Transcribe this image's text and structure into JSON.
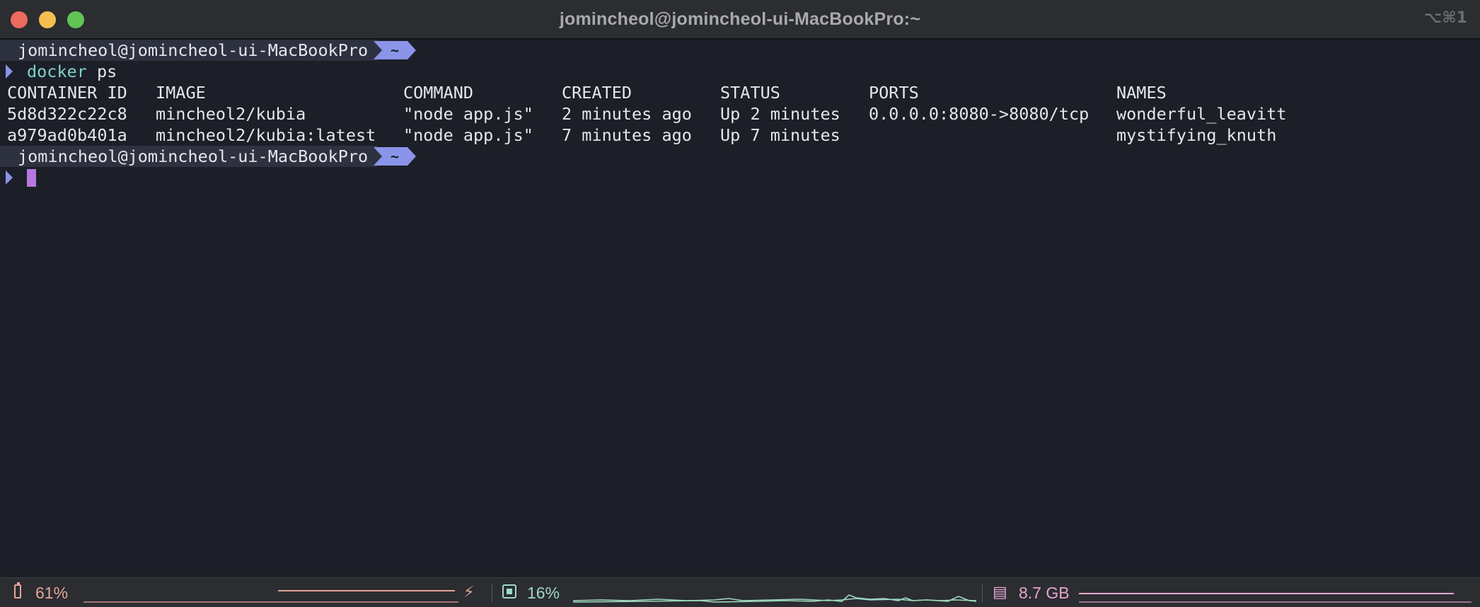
{
  "window": {
    "title": "jomincheol@jomincheol-ui-MacBookPro:~",
    "shortcut": "⌥⌘1",
    "traffic_colors": {
      "close": "#ed6a5e",
      "minimize": "#f5bf4f",
      "maximize": "#61c554"
    }
  },
  "prompt": {
    "host": "jomincheol@jomincheol-ui-MacBookPro",
    "dir": "~"
  },
  "command": {
    "name": "docker",
    "args": " ps"
  },
  "table": {
    "headers": [
      "CONTAINER ID",
      "IMAGE",
      "COMMAND",
      "CREATED",
      "STATUS",
      "PORTS",
      "NAMES"
    ],
    "rows": [
      [
        "5d8d322c22c8",
        "mincheol2/kubia",
        "\"node app.js\"",
        "2 minutes ago",
        "Up 2 minutes",
        "0.0.0.0:8080->8080/tcp",
        "wonderful_leavitt"
      ],
      [
        "a979ad0b401a",
        "mincheol2/kubia:latest",
        "\"node app.js\"",
        "7 minutes ago",
        "Up 7 minutes",
        "",
        "mystifying_knuth"
      ]
    ]
  },
  "statusbar": {
    "battery": "61%",
    "cpu": "16%",
    "memory": "8.7 GB",
    "icons": [
      "battery-icon",
      "bolt-icon",
      "cpu-icon",
      "memory-icon"
    ],
    "colors": {
      "battery": "#e3a59a",
      "cpu": "#9fd8c3",
      "memory": "#e5a5cf"
    }
  },
  "colors": {
    "background": "#1c1f27",
    "prompt_bg": "#2d3140",
    "accent": "#8a94e8",
    "command": "#7dd3c6",
    "cursor": "#b777e0"
  }
}
